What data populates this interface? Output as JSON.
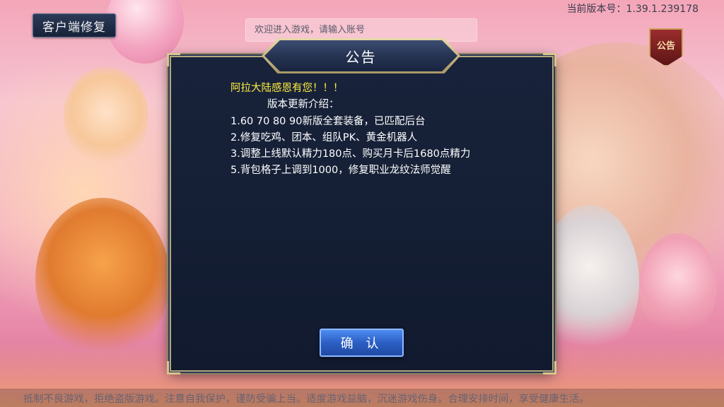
{
  "header": {
    "repair_button_label": "客户端修复",
    "version_text": "当前版本号：1.39.1.239178",
    "account_input_placeholder": "欢迎进入游戏，请输入账号"
  },
  "notice_icon": {
    "label": "公告",
    "icon": "notice-badge"
  },
  "modal": {
    "title": "公告",
    "heading": "阿拉大陆感恩有您！！！",
    "changelog_title": "版本更新介绍：",
    "changelog_items": [
      "1.60 70 80 90新版全套装备，已匹配后台",
      "2.修复吃鸡、团本、组队PK、黄金机器人",
      "3.调整上线默认精力180点、购买月卡后1680点精力",
      "5.背包格子上调到1000，修复职业龙纹法师觉醒"
    ],
    "confirm_button_label": "确 认"
  },
  "footer": {
    "health_advisory": "抵制不良游戏，拒绝盗版游戏。注意自我保护，谨防受骗上当。适度游戏益脑，沉迷游戏伤身。合理安排时间，享受健康生活。"
  },
  "colors": {
    "modal_bg": "#141e34",
    "modal_border": "#b3a77c",
    "heading_yellow": "#ffec3d",
    "confirm_blue": "#2c5fc4",
    "notice_red": "#7a2020"
  }
}
